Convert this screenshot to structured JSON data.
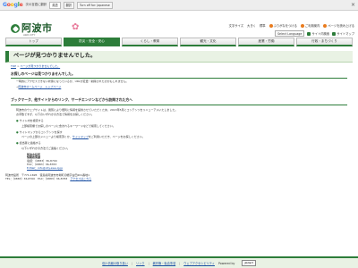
{
  "translate_bar": {
    "logo": "Google",
    "label": "次の言語に翻訳",
    "select": "英語",
    "translate_btn": "翻訳",
    "off_btn": "Turn off for: Japanese"
  },
  "header": {
    "logo_text": "阿波市",
    "logo_sub": "AWA CITY",
    "links": [
      "文字サイズ",
      "大きく",
      "標準",
      "ふりがなをつける",
      "ご利用案内",
      "ページを読み上げる"
    ],
    "search_label": "サイト内検索",
    "sitemap": "サイトマップ",
    "language": "Select Language"
  },
  "nav": {
    "items": [
      "トップ",
      "防災・安全・安心",
      "くらし・教育",
      "観光・文化",
      "産業・労働",
      "行政・まちづくり"
    ],
    "active_index": 1
  },
  "page": {
    "title": "ページが見つかりませんでした。",
    "breadcrumb_top": "TOP",
    "breadcrumb_current": "ページが見つかりませんでした。",
    "sec1_heading": "お探しのページは見つかりませんでした。",
    "sec1_text": "一時的にアクセスできない状態になっているか、URLが変更・削除されたのかもしれません。",
    "sec1_link": "阿波市ホームページ　トップページ",
    "sec2_heading": "ブックマーク、他サイトからのリンク、サーチエンジンなどから訪問された方へ",
    "sec2_p1": "阿波市のウェブサイトは、閲覧により便利に情報を提供させていただくため、2013年5月にコンテンツをリニューアルいたしました。",
    "sec2_p2": "お手数ですが、以下のいずれかの方法で情報をお探しください。",
    "item1_title": "サイト内を検索する",
    "item1_text": "上部検索欄でお探しのページに含まれるキーワードなどで検索してください。",
    "item2_title": "サイトマップからコンテンツを探す",
    "item2_text_pre": "ページの上部のメニューより検索頂くか、",
    "item2_link": "サイトマップ",
    "item2_text_post": "をご利用いただき、ページをお探しください。",
    "item3_title": "担当者に連絡する",
    "item3_text": "以下いずれかの方法でご連絡ください。",
    "contact_dept": "阿波市役所",
    "contact_div": "情報政策課",
    "contact_tel": "電話：（0883）36-8700",
    "contact_fax": "FAX：（0883）36-8783",
    "contact_email": "E-Mail：info@city.awa.lg.jp"
  },
  "footer": {
    "address": "阿波市役所　〒771-1695　徳島県阿波市市場町切幡字古田201番地1",
    "phone": "TEL：（0883）36-8700　FAX：（0883）36-8783",
    "access": "アクセスはこちら",
    "links": [
      "個人情報の取り扱い",
      "リンク",
      "著作権・免責事項",
      "ウェブアクセシビリティ"
    ],
    "powered": "Powered by",
    "cms": "Joruri"
  }
}
